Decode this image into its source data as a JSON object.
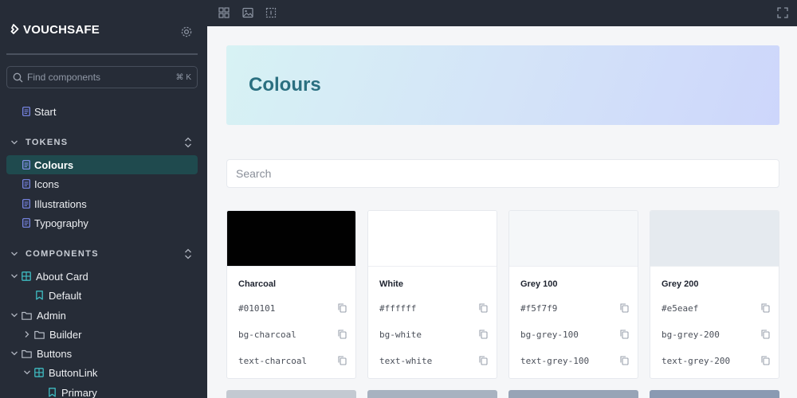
{
  "app": {
    "brand": "VOUCHSAFE",
    "brand_icon": "vouchsafe-logo-icon",
    "settings_icon": "gear-icon"
  },
  "sidebar": {
    "search": {
      "placeholder": "Find components",
      "shortcut": "⌘ K",
      "icon": "search-icon"
    },
    "start": {
      "label": "Start",
      "icon": "document-icon"
    },
    "tokens": {
      "title": "TOKENS",
      "items": [
        {
          "label": "Colours",
          "active": true,
          "icon": "document-icon"
        },
        {
          "label": "Icons",
          "active": false,
          "icon": "document-icon"
        },
        {
          "label": "Illustrations",
          "active": false,
          "icon": "document-icon"
        },
        {
          "label": "Typography",
          "active": false,
          "icon": "document-icon"
        }
      ]
    },
    "components": {
      "title": "COMPONENTS",
      "items": [
        {
          "label": "About Card",
          "icon": "component-icon"
        },
        {
          "label": "Default",
          "icon": "bookmark-icon"
        },
        {
          "label": "Admin",
          "icon": "folder-icon"
        },
        {
          "label": "Builder",
          "icon": "folder-icon"
        },
        {
          "label": "Buttons",
          "icon": "folder-icon"
        },
        {
          "label": "ButtonLink",
          "icon": "component-icon"
        },
        {
          "label": "Primary",
          "icon": "bookmark-icon"
        }
      ]
    }
  },
  "toolbar": {
    "icons": [
      "grid-icon",
      "image-icon",
      "measure-icon",
      "fullscreen-icon"
    ]
  },
  "main": {
    "title": "Colours",
    "search_placeholder": "Search",
    "swatches": [
      {
        "name": "Charcoal",
        "hex": "#010101",
        "bg": "bg-charcoal",
        "text": "text-charcoal",
        "color": "#010101"
      },
      {
        "name": "White",
        "hex": "#ffffff",
        "bg": "bg-white",
        "text": "text-white",
        "color": "#ffffff"
      },
      {
        "name": "Grey 100",
        "hex": "#f5f7f9",
        "bg": "bg-grey-100",
        "text": "text-grey-100",
        "color": "#f5f7f9"
      },
      {
        "name": "Grey 200",
        "hex": "#e5eaef",
        "bg": "bg-grey-200",
        "text": "text-grey-200",
        "color": "#e5eaef"
      }
    ],
    "next_row_colors": [
      "#c3c9d1",
      "#a8b2c0",
      "#97a4b6",
      "#8a9ab2"
    ]
  }
}
